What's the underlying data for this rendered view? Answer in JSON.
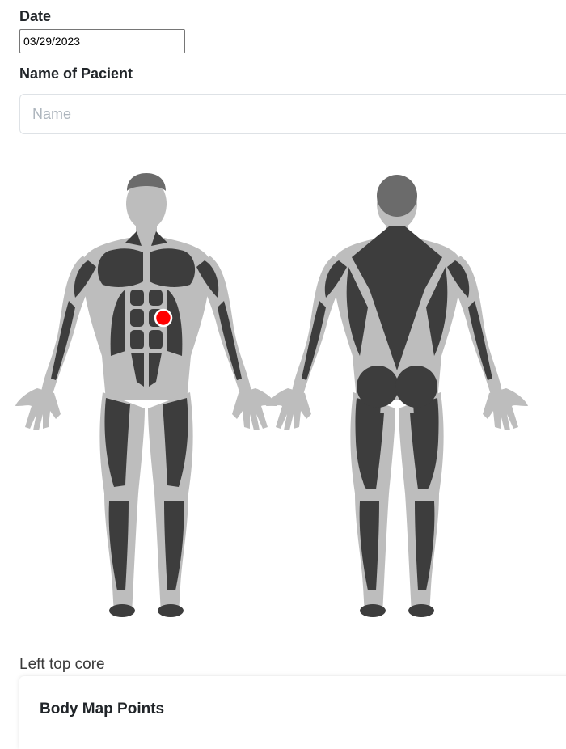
{
  "form": {
    "date_label": "Date",
    "date_value": "03/29/2023",
    "name_label": "Name of Pacient",
    "name_placeholder": "Name",
    "name_value": ""
  },
  "body_map": {
    "views": [
      "front",
      "back"
    ],
    "marker_color": "#ff0000",
    "skin_color": "#bdbdbd",
    "muscle_color": "#3d3d3d",
    "selected_region": "Left top core"
  },
  "points_card": {
    "title": "Body Map Points"
  }
}
